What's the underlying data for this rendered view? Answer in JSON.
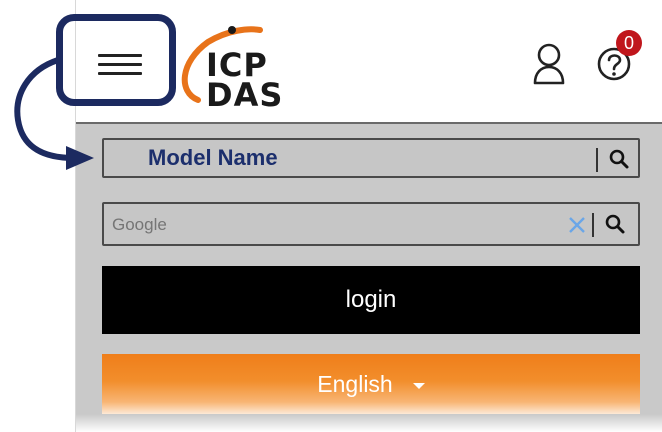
{
  "header": {
    "menu_icon": "hamburger-menu-icon",
    "logo_line1": "ICP",
    "logo_line2": "DAS",
    "user_icon": "user-icon",
    "help_icon": "help-icon",
    "help_badge": "0",
    "colors": {
      "logo_orange": "#e8731a",
      "badge_red": "#c0161c"
    }
  },
  "search": {
    "model_label": "Model Name",
    "google_placeholder": "Google",
    "search_icon": "search-icon",
    "clear_icon": "close-icon"
  },
  "login": {
    "label": "login"
  },
  "language": {
    "selected": "English"
  },
  "annotation": {
    "highlight_color": "#1c2a60"
  }
}
